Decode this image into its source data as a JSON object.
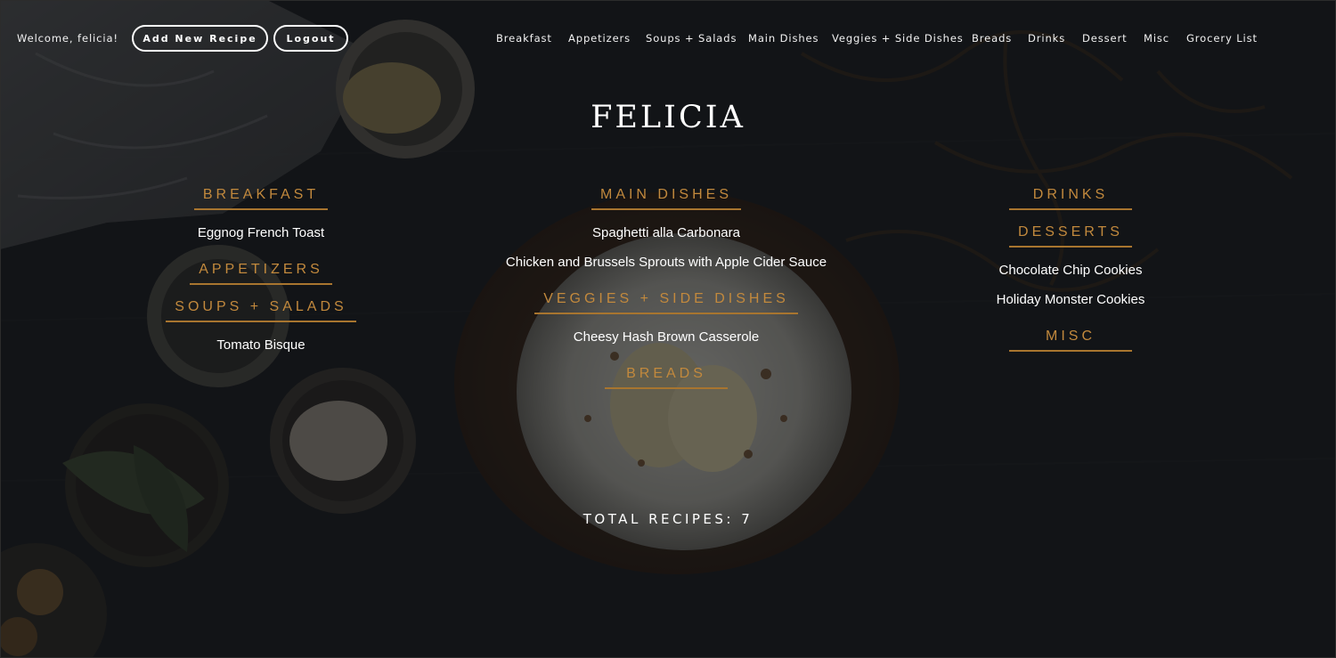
{
  "header": {
    "welcome_text": "Welcome, felicia!",
    "add_recipe_label": "Add New Recipe",
    "logout_label": "Logout",
    "nav": [
      "Breakfast",
      "Appetizers",
      "Soups + Salads",
      "Main Dishes",
      "Veggies + Side Dishes",
      "Breads",
      "Drinks",
      "Dessert",
      "Misc",
      "Grocery List"
    ]
  },
  "page": {
    "title": "FELICIA",
    "total_recipes": "TOTAL RECIPES: 7"
  },
  "columns": {
    "left": [
      {
        "heading": "BREAKFAST",
        "recipes": [
          "Eggnog French Toast"
        ]
      },
      {
        "heading": "APPETIZERS",
        "recipes": []
      },
      {
        "heading": "SOUPS + SALADS",
        "recipes": [
          "Tomato Bisque"
        ]
      }
    ],
    "center": [
      {
        "heading": "MAIN DISHES",
        "recipes": [
          "Spaghetti alla Carbonara",
          "Chicken and Brussels Sprouts with Apple Cider Sauce"
        ]
      },
      {
        "heading": "VEGGIES + SIDE DISHES",
        "recipes": [
          "Cheesy Hash Brown Casserole"
        ]
      },
      {
        "heading": "BREADS",
        "recipes": []
      }
    ],
    "right": [
      {
        "heading": "DRINKS",
        "recipes": []
      },
      {
        "heading": "DESSERTS",
        "recipes": [
          "Chocolate Chip Cookies",
          "Holiday Monster Cookies"
        ]
      },
      {
        "heading": "MISC",
        "recipes": []
      }
    ]
  },
  "colors": {
    "accent": "#c2893d",
    "background": "#15171a",
    "text": "#ffffff"
  }
}
